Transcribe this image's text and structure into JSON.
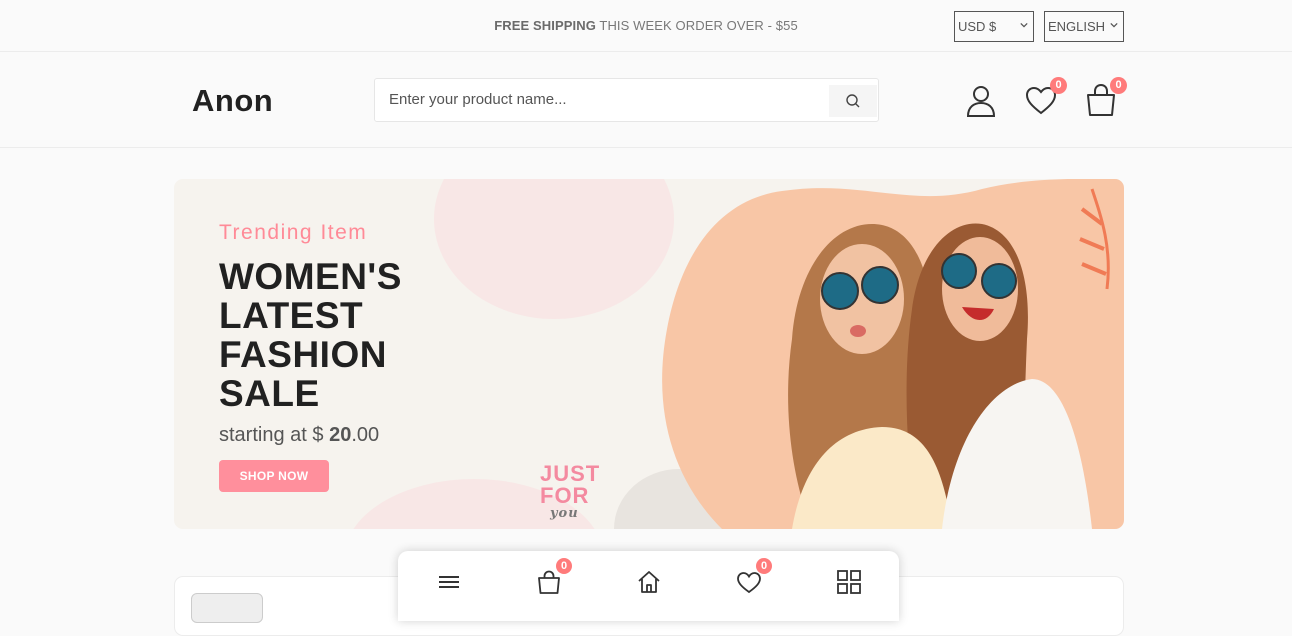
{
  "topbar": {
    "shipping_bold": "FREE SHIPPING",
    "shipping_rest": "THIS WEEK ORDER OVER - $55",
    "currency": "USD $",
    "language": "ENGLISH"
  },
  "header": {
    "logo": "Anon",
    "search_placeholder": "Enter your product name...",
    "wishlist_count": "0",
    "cart_count": "0"
  },
  "banner": {
    "subtitle": "Trending Item",
    "title": "WOMEN'S LATEST FASHION SALE",
    "price_prefix": "starting at $",
    "price_bold": "20",
    "price_suffix": ".00",
    "button": "SHOP NOW",
    "deco_line1": "JUST",
    "deco_line2": "FOR",
    "deco_line3": "you"
  },
  "bottom_nav": {
    "cart_count": "0",
    "wishlist_count": "0"
  },
  "colors": {
    "accent": "#ff8f9c",
    "badge": "#ff7b7b",
    "text": "#212121"
  }
}
